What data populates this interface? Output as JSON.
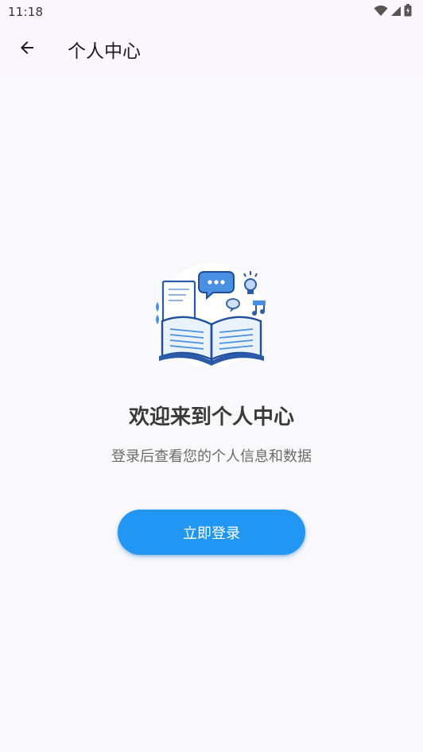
{
  "status_bar": {
    "time": "11:18",
    "icons": [
      "wifi-icon",
      "signal-icon",
      "battery-icon"
    ]
  },
  "app_bar": {
    "title": "个人中心",
    "back_icon": "arrow-back-icon"
  },
  "main": {
    "illustration_icon": "open-book-with-chat-and-idea-icon",
    "welcome_title": "欢迎来到个人中心",
    "subtitle": "登录后查看您的个人信息和数据",
    "login_button_label": "立即登录"
  },
  "colors": {
    "accent": "#2196f3",
    "background": "#f9f8fa",
    "appbar_background": "#fbf6fd"
  }
}
